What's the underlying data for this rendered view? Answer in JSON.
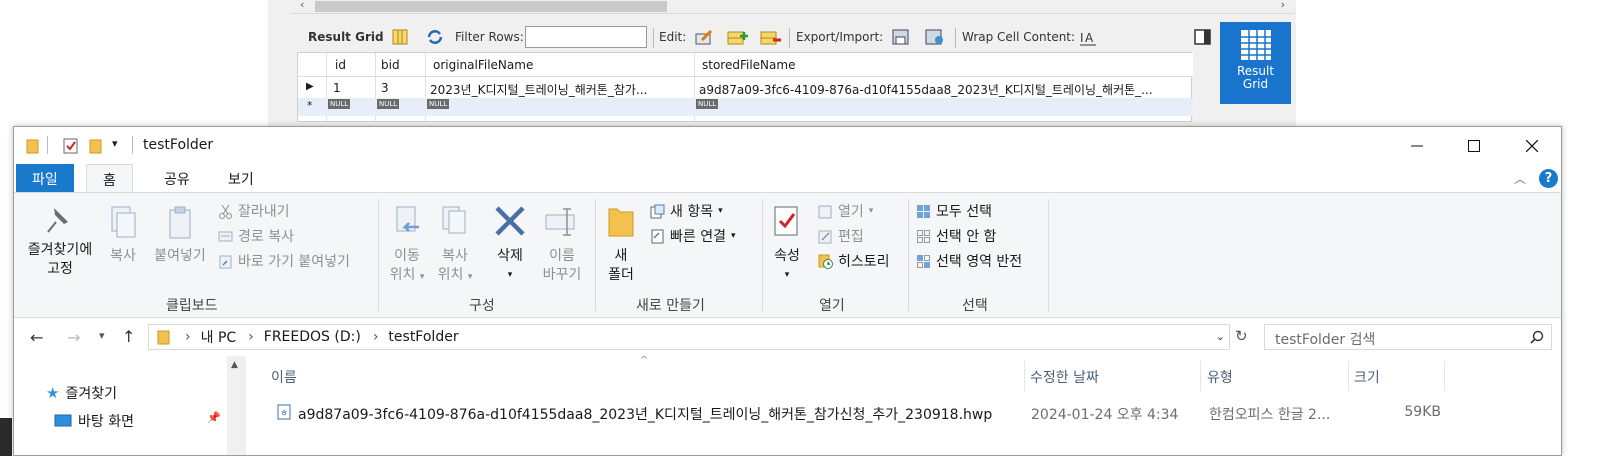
{
  "workbench": {
    "toolbar": {
      "result_grid": "Result Grid",
      "filter_rows": "Filter Rows:",
      "edit": "Edit:",
      "export_import": "Export/Import:",
      "wrap_cell": "Wrap Cell Content:"
    },
    "grid": {
      "columns": [
        "id",
        "bid",
        "originalFileName",
        "storedFileName"
      ],
      "row": [
        "1",
        "3",
        "2023년_K디지털_트레이닝_해커톤_참가...",
        "a9d87a09-3fc6-4109-876a-d10f4155daa8_2023년_K디지털_트레이닝_해커톤_..."
      ],
      "null_label": "NULL"
    },
    "side_panel": {
      "line1": "Result",
      "line2": "Grid"
    }
  },
  "explorer": {
    "title": "testFolder",
    "tabs": {
      "file": "파일",
      "home": "홈",
      "share": "공유",
      "view": "보기"
    },
    "ribbon": {
      "clipboard": {
        "label": "클립보드",
        "pin_line1": "즐겨찾기에",
        "pin_line2": "고정",
        "copy": "복사",
        "paste": "붙여넣기",
        "cut": "잘라내기",
        "copy_path": "경로 복사",
        "paste_shortcut": "바로 가기 붙여넣기"
      },
      "organize": {
        "label": "구성",
        "move_line1": "이동",
        "move_line2": "위치",
        "copyto_line1": "복사",
        "copyto_line2": "위치",
        "delete": "삭제",
        "rename_line1": "이름",
        "rename_line2": "바꾸기"
      },
      "new": {
        "label": "새로 만들기",
        "folder_line1": "새",
        "folder_line2": "폴더",
        "new_item": "새 항목",
        "easy_access": "빠른 연결"
      },
      "open": {
        "label": "열기",
        "properties": "속성",
        "open": "열기",
        "edit": "편집",
        "history": "히스토리"
      },
      "select": {
        "label": "선택",
        "select_all": "모두 선택",
        "select_none": "선택 안 함",
        "invert": "선택 영역 반전"
      }
    },
    "address": {
      "crumbs": [
        "내 PC",
        "FREEDOS (D:)",
        "testFolder"
      ],
      "search_placeholder": "testFolder 검색"
    },
    "nav": {
      "favorites": "즐겨찾기",
      "desktop": "바탕 화면"
    },
    "columns": {
      "name": "이름",
      "modified": "수정한 날짜",
      "type": "유형",
      "size": "크기"
    },
    "files": [
      {
        "name": "a9d87a09-3fc6-4109-876a-d10f4155daa8_2023년_K디지털_트레이닝_해커톤_참가신청_추가_230918.hwp",
        "modified": "2024-01-24 오후 4:34",
        "type": "한컴오피스 한글 2...",
        "size": "59KB"
      }
    ]
  }
}
